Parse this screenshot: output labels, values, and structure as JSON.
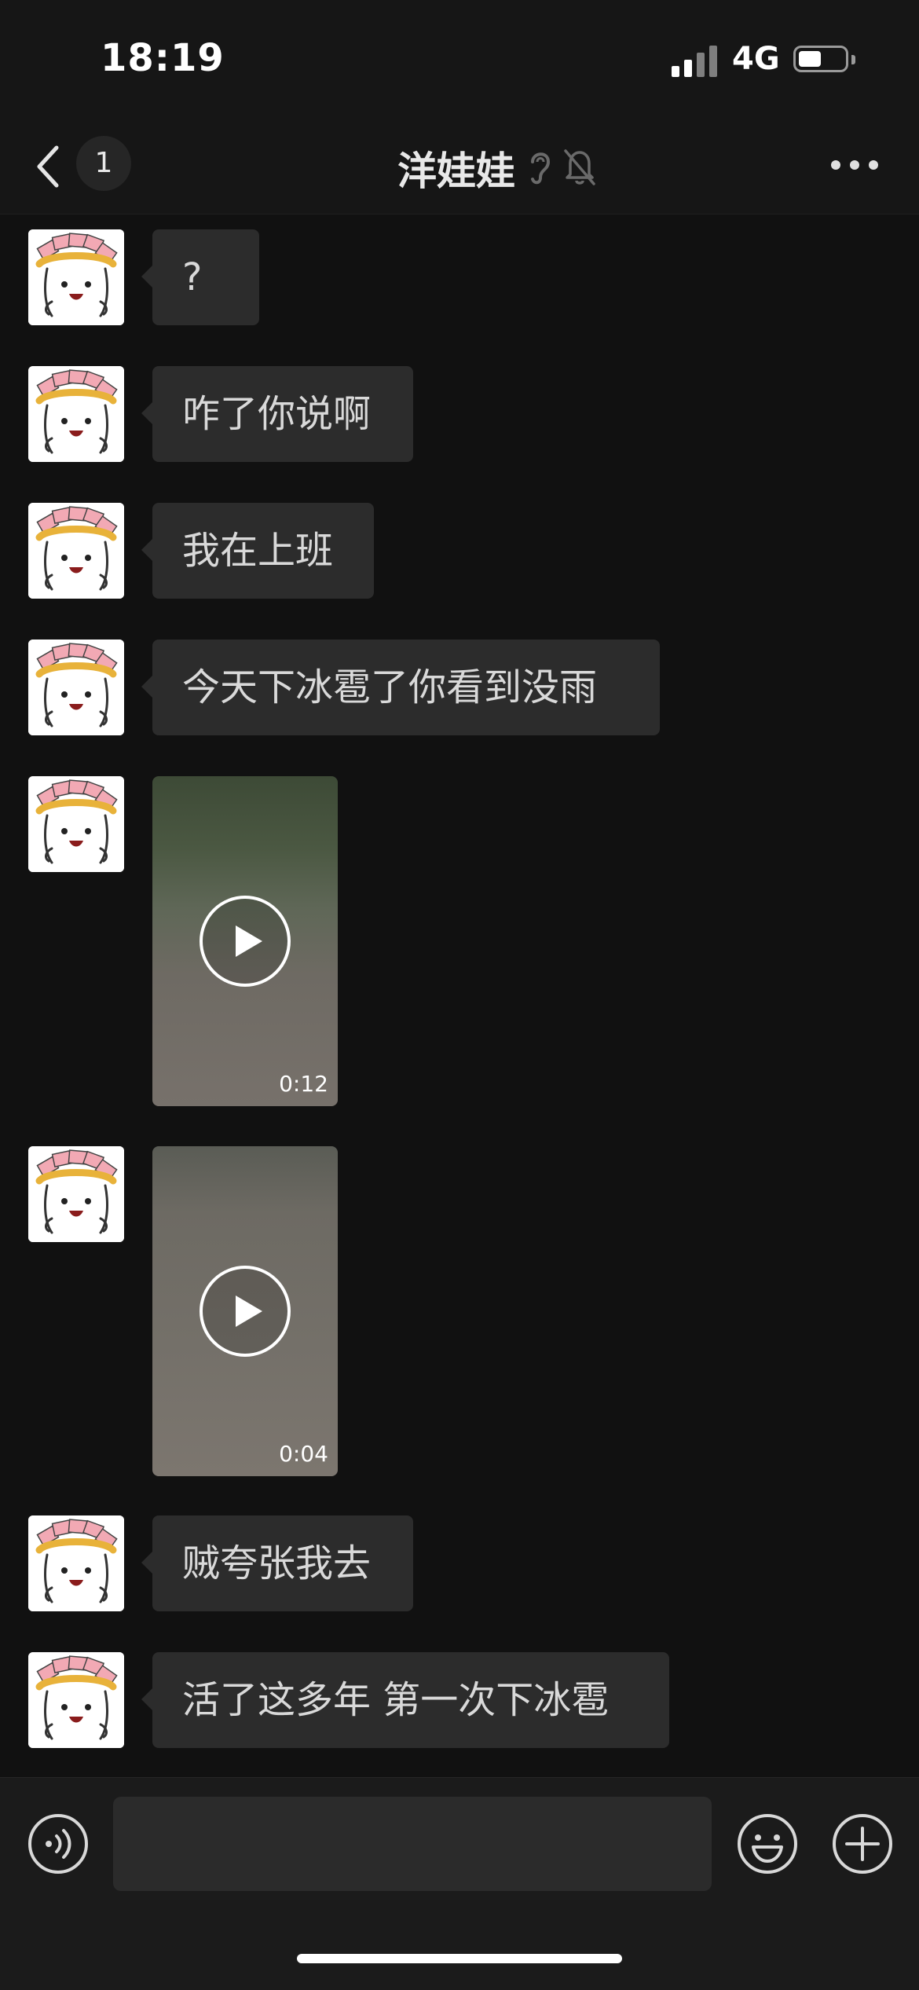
{
  "status_bar": {
    "time": "18:19",
    "network": "4G",
    "battery_icon": "battery-low-icon"
  },
  "header": {
    "unread_count": "1",
    "title": "洋娃娃",
    "icons": [
      "back-chevron-icon",
      "ear-icon",
      "muted-bell-icon",
      "more-dots-icon"
    ]
  },
  "messages": [
    {
      "type": "text",
      "text": "?"
    },
    {
      "type": "text",
      "text": "咋了你说啊"
    },
    {
      "type": "text",
      "text": "我在上班"
    },
    {
      "type": "text",
      "text": "今天下冰雹了你看到没雨"
    },
    {
      "type": "video",
      "duration": "0:12"
    },
    {
      "type": "video",
      "duration": "0:04"
    },
    {
      "type": "text",
      "text": "贼夸张我去"
    },
    {
      "type": "text",
      "text": "活了这多年 第一次下冰雹"
    }
  ],
  "input_bar": {
    "icons": [
      "voice-icon",
      "emoji-icon",
      "plus-icon"
    ],
    "value": ""
  },
  "colors": {
    "background": "#111111",
    "bubble": "#2c2c2c",
    "text": "#d9d9d9"
  }
}
